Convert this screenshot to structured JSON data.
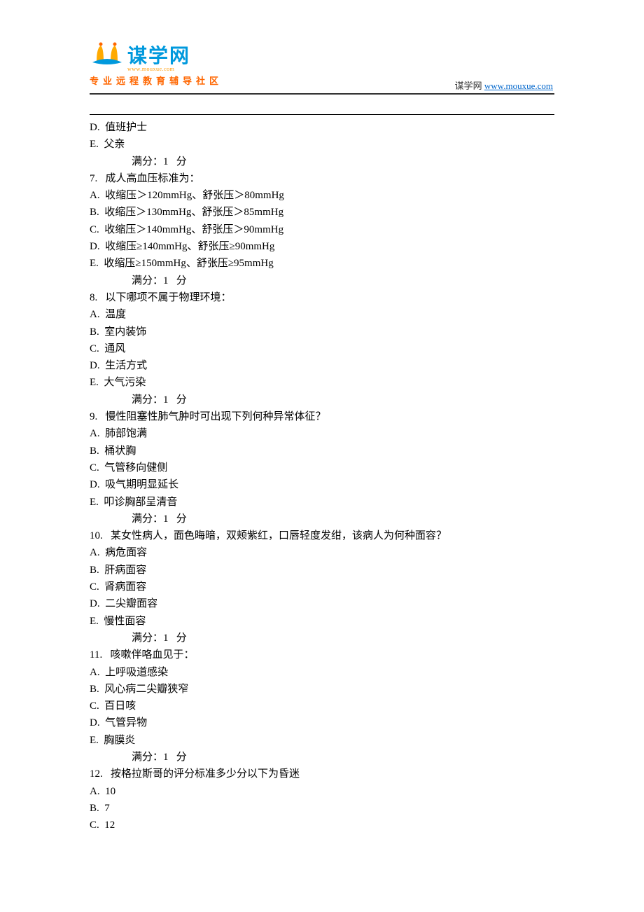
{
  "header": {
    "logo_text": "谋学网",
    "logo_url_small": "www.mouxue.com",
    "logo_subtitle": "专业远程教育辅导社区",
    "site_label": "谋学网 ",
    "site_url": "www.mouxue.com"
  },
  "prior_options": [
    "D.  值班护士",
    "E.  父亲"
  ],
  "score_line": "满分：1   分",
  "questions": [
    {
      "num": "7.",
      "stem": "成人高血压标准为：",
      "options": [
        "A.  收缩压＞120mmHg、舒张压＞80mmHg",
        "B.  收缩压＞130mmHg、舒张压＞85mmHg",
        "C.  收缩压＞140mmHg、舒张压＞90mmHg",
        "D.  收缩压≥140mmHg、舒张压≥90mmHg",
        "E.  收缩压≥150mmHg、舒张压≥95mmHg"
      ]
    },
    {
      "num": "8.",
      "stem": "以下哪项不属于物理环境：",
      "options": [
        "A.  温度",
        "B.  室内装饰",
        "C.  通风",
        "D.  生活方式",
        "E.  大气污染"
      ]
    },
    {
      "num": "9.",
      "stem": "慢性阻塞性肺气肿时可出现下列何种异常体征？",
      "options": [
        "A.  肺部饱满",
        "B.  桶状胸",
        "C.  气管移向健侧",
        "D.  吸气期明显延长",
        "E.  叩诊胸部呈清音"
      ]
    },
    {
      "num": "10.",
      "stem": "某女性病人，面色晦暗，双颊紫红，口唇轻度发绀，该病人为何种面容？",
      "options": [
        "A.  病危面容",
        "B.  肝病面容",
        "C.  肾病面容",
        "D.  二尖瓣面容",
        "E.  慢性面容"
      ]
    },
    {
      "num": "11.",
      "stem": "咳嗽伴咯血见于：",
      "options": [
        "A.  上呼吸道感染",
        "B.  风心病二尖瓣狭窄",
        "C.  百日咳",
        "D.  气管异物",
        "E.  胸膜炎"
      ]
    },
    {
      "num": "12.",
      "stem": "按格拉斯哥的评分标准多少分以下为昏迷",
      "options": [
        "A.  10",
        "B.  7",
        "C.  12"
      ],
      "no_score": true
    }
  ]
}
